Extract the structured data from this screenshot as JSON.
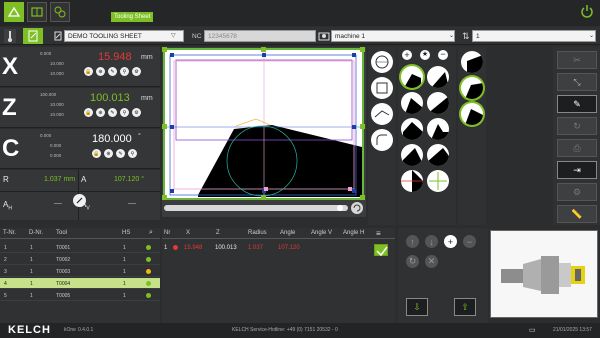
{
  "top": {
    "tooltip": "Tooling Sheet"
  },
  "toolrow": {
    "sheet_name": "DEMO TOOLING SHEET",
    "nc_label": "NC",
    "nc_value": "12345678",
    "machine": "machine 1",
    "number": "1"
  },
  "axes": {
    "x": {
      "letter": "X",
      "value": "15.948",
      "unit": "mm",
      "mini": [
        "0.000",
        "10.000",
        "10.000"
      ]
    },
    "z": {
      "letter": "Z",
      "value": "100.013",
      "unit": "mm",
      "mini": [
        "100.000",
        "10.000",
        "10.000"
      ]
    },
    "c": {
      "letter": "C",
      "value": "180.000",
      "unit": "°",
      "mini": [
        "0.000",
        "0.000",
        "0.000"
      ]
    }
  },
  "results": {
    "r_label": "R",
    "r_value": "1.037 mm",
    "a_label": "A",
    "a_value": "107.120 °",
    "ah_label": "A",
    "ah_sub": "H",
    "ah_value": "----",
    "av_label": "A",
    "av_sub": "V",
    "av_value": "----"
  },
  "toollist": {
    "headers": [
      "T-Nr.",
      "D-Nr.",
      "Tool",
      "HS"
    ],
    "rows": [
      {
        "t": "1",
        "d": "1",
        "tool": "T0001",
        "hs": "1",
        "status": "green"
      },
      {
        "t": "2",
        "d": "1",
        "tool": "T0002",
        "hs": "1",
        "status": "green"
      },
      {
        "t": "3",
        "d": "1",
        "tool": "T0003",
        "hs": "1",
        "status": "orange"
      },
      {
        "t": "4",
        "d": "1",
        "tool": "T0004",
        "hs": "1",
        "status": "green"
      },
      {
        "t": "5",
        "d": "1",
        "tool": "T0005",
        "hs": "1",
        "status": "green"
      }
    ]
  },
  "measure": {
    "headers": [
      "Nr",
      "X",
      "Z",
      "Radius",
      "Angle",
      "Angle V",
      "Angle H"
    ],
    "row": {
      "nr": "1",
      "x": "15.948",
      "z": "100.013",
      "radius": "1.037",
      "angle": "107.120"
    }
  },
  "status": {
    "brand": "KELCH",
    "product": "kOne",
    "version": "0.4.0.1",
    "hotline": "KELCH Service-Hotline: +49 (0) 7151 20532 - 0",
    "datetime": "21/01/2025 13:57"
  },
  "colors": {
    "accent": "#7fbf26",
    "red": "#e53935",
    "orange": "#f39c12"
  }
}
